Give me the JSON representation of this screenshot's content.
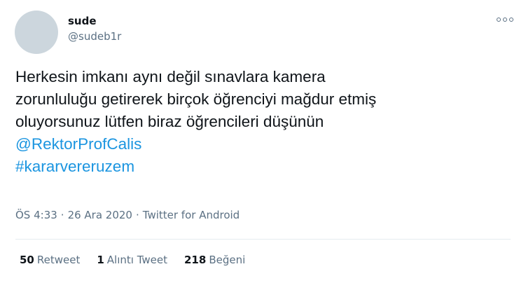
{
  "user": {
    "display_name": "sude",
    "handle": "@sudeb1r"
  },
  "tweet": {
    "text_lines": [
      "Herkesin imkanı aynı değil sınavlara kamera",
      "zorunluluğu getirerek birçok öğrenciyi mağdur etmiş",
      "oluyorsunuz lütfen biraz öğrencileri düşünün"
    ],
    "mention": "@RektorProfCalis",
    "hashtag": "#kararvereruzem",
    "time": "ÖS 4:33",
    "separator": "·",
    "date": "26 Ara 2020",
    "source": "Twitter for Android"
  },
  "stats": {
    "retweets": {
      "count": "50",
      "label": "Retweet"
    },
    "quotes": {
      "count": "1",
      "label": "Alıntı Tweet"
    },
    "likes": {
      "count": "218",
      "label": "Beğeni"
    }
  },
  "icons": {
    "more": "more-horizontal-icon"
  },
  "colors": {
    "link": "#1b95e0",
    "secondary_text": "#5b7083",
    "primary_text": "#0f1419",
    "avatar_placeholder": "#ccd6dd",
    "divider": "#e6ecf0"
  }
}
